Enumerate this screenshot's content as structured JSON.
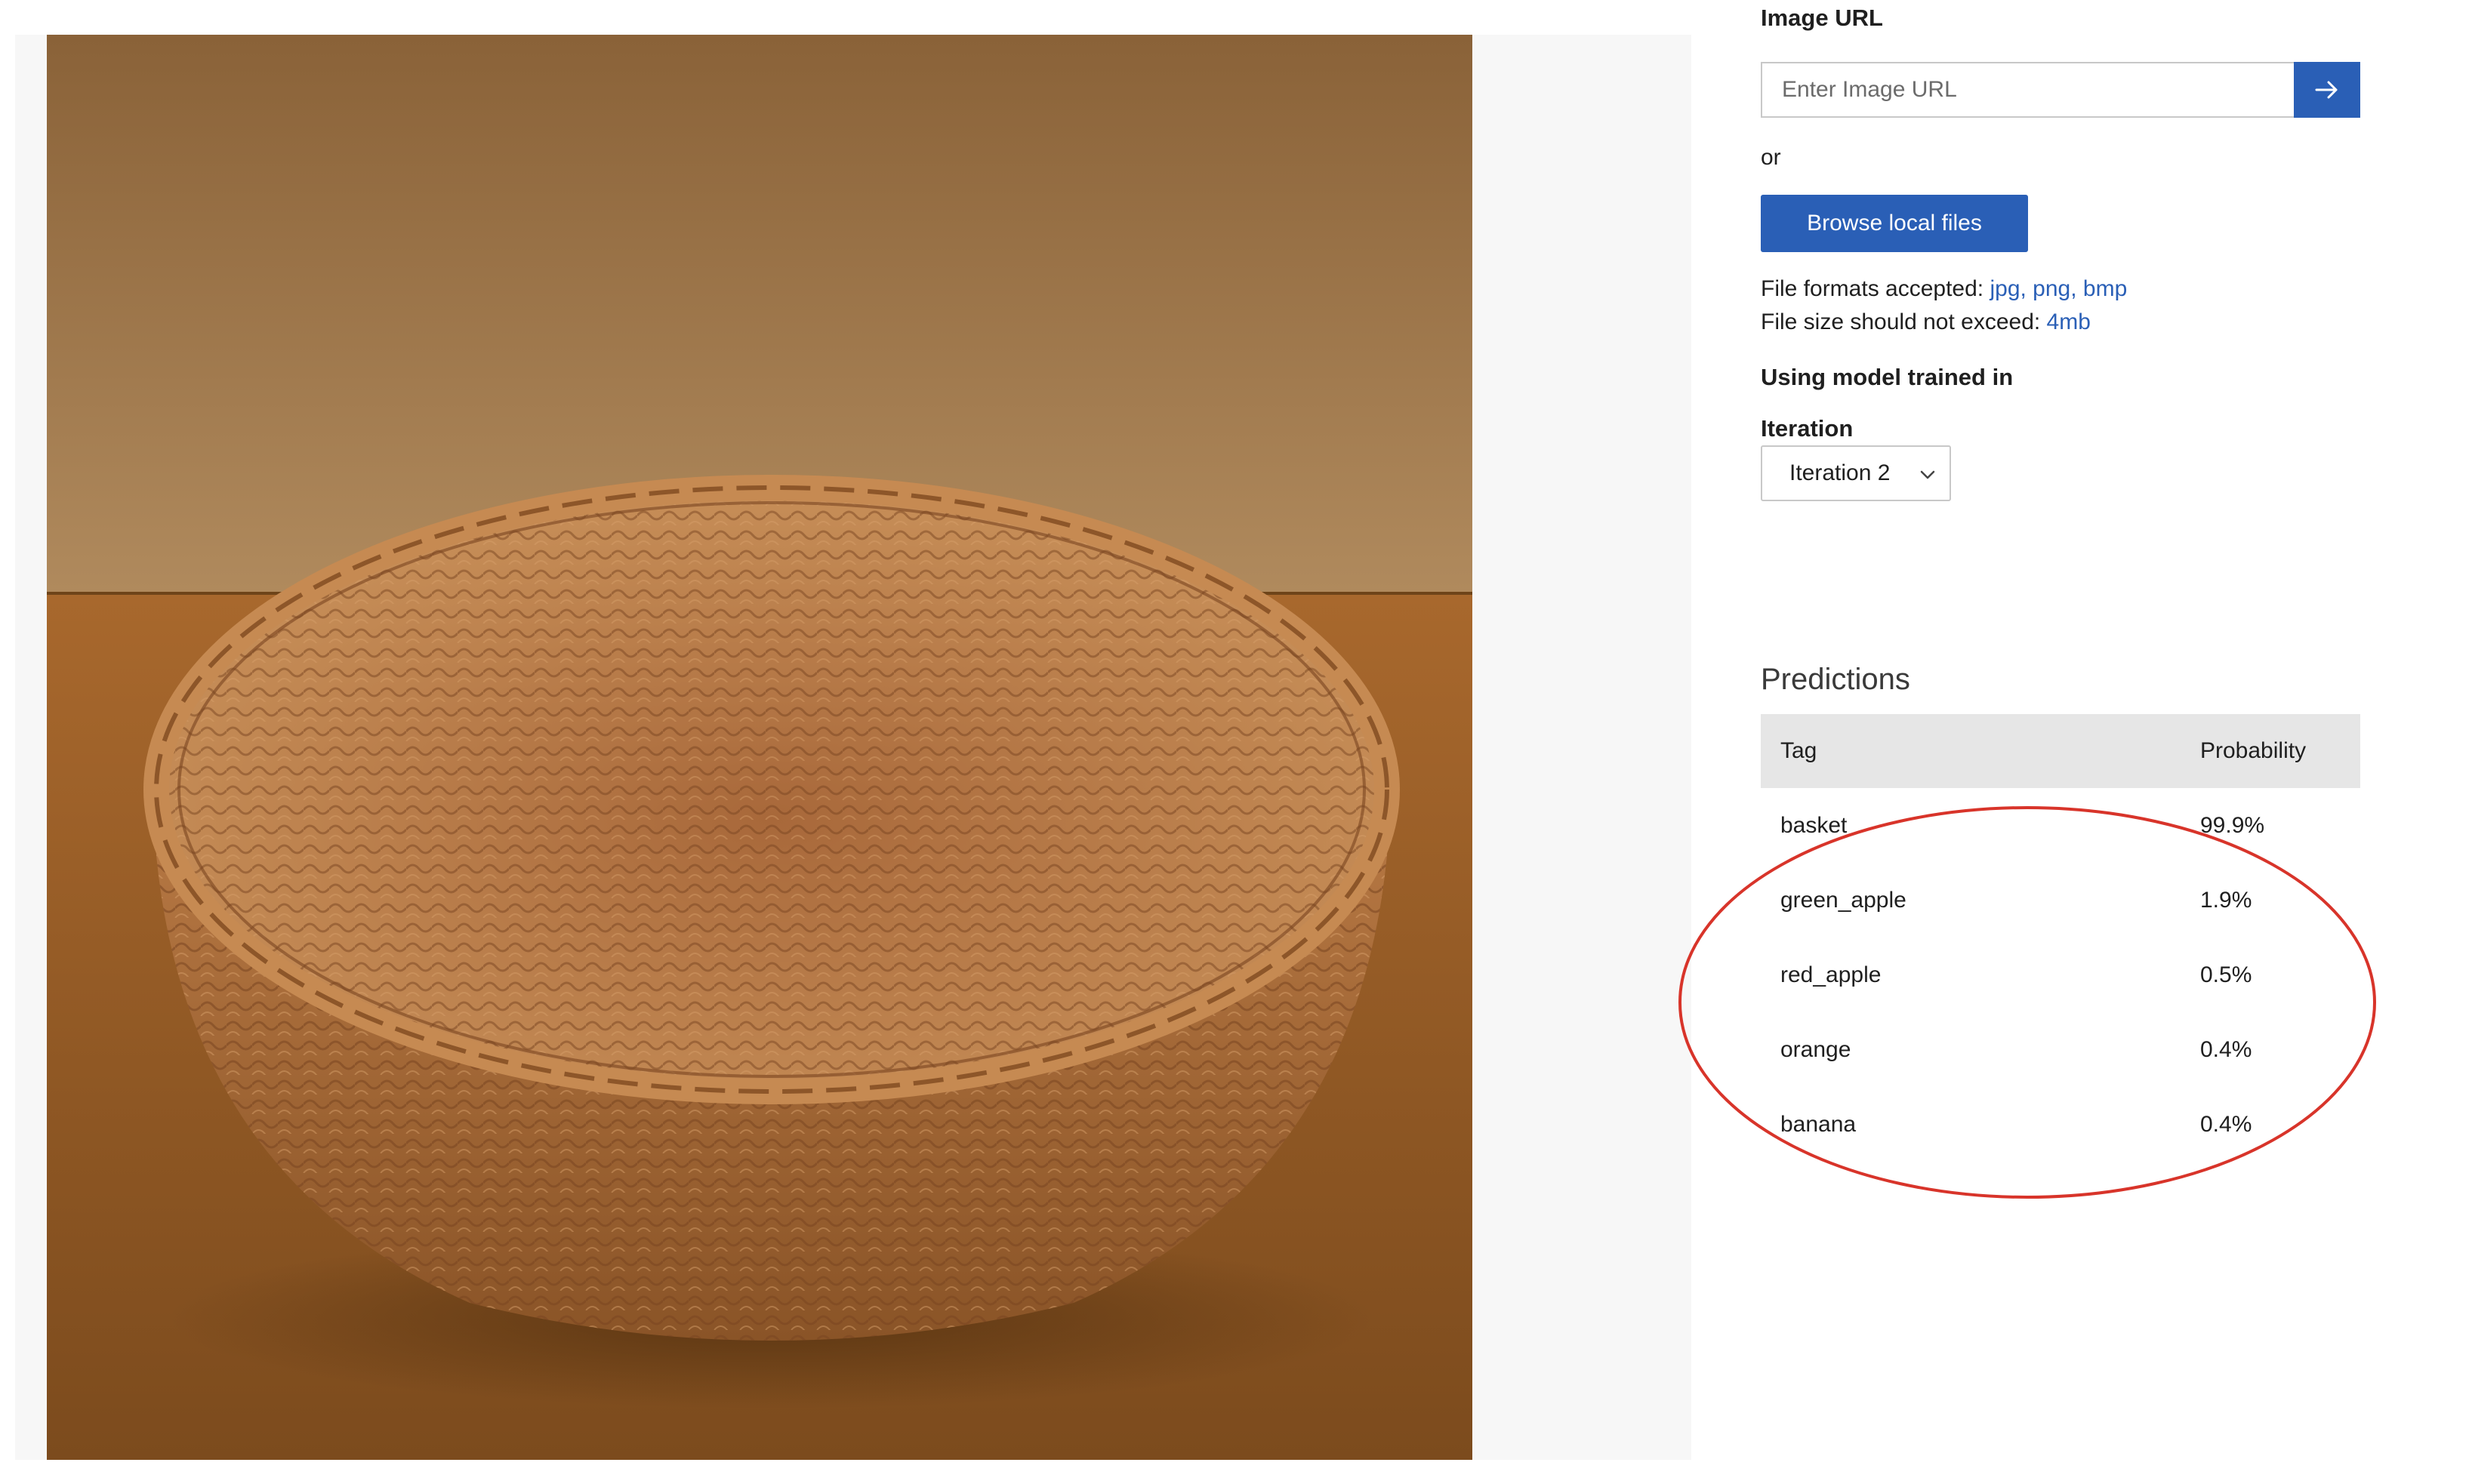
{
  "image_url": {
    "label": "Image URL",
    "placeholder": "Enter Image URL",
    "submit_icon": "arrow-right-icon"
  },
  "or_text": "or",
  "browse": {
    "label": "Browse local files"
  },
  "file_formats": {
    "prefix": "File formats accepted: ",
    "formats": "jpg, png, bmp"
  },
  "file_size": {
    "prefix": "File size should not exceed: ",
    "limit": "4mb"
  },
  "model": {
    "heading": "Using model trained in",
    "iteration_label": "Iteration",
    "iteration_selected": "Iteration 2"
  },
  "predictions": {
    "title": "Predictions",
    "columns": [
      "Tag",
      "Probability"
    ],
    "rows": [
      {
        "tag": "basket",
        "probability": "99.9%"
      },
      {
        "tag": "green_apple",
        "probability": "1.9%"
      },
      {
        "tag": "red_apple",
        "probability": "0.5%"
      },
      {
        "tag": "orange",
        "probability": "0.4%"
      },
      {
        "tag": "banana",
        "probability": "0.4%"
      }
    ]
  },
  "colors": {
    "accent": "#2a5fb6",
    "annotation": "#d8342a",
    "table_header": "#e6e6e6"
  }
}
